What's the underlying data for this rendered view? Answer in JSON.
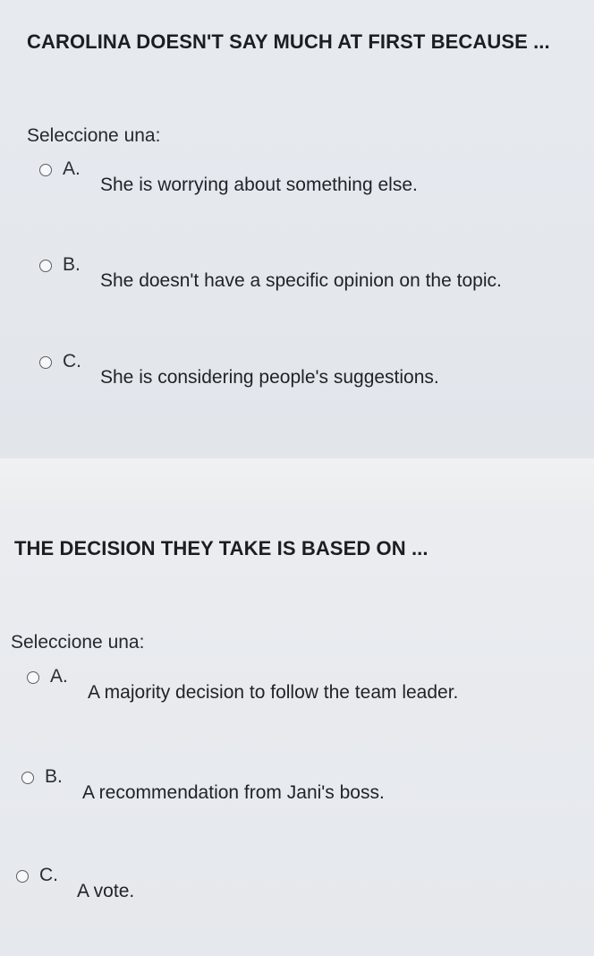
{
  "questions": [
    {
      "title": "CAROLINA DOESN'T SAY MUCH AT FIRST BECAUSE ...",
      "prompt": "Seleccione una:",
      "options": [
        {
          "letter": "A.",
          "text": "She is worrying about something else."
        },
        {
          "letter": "B.",
          "text": "She doesn't have a specific opinion on the topic."
        },
        {
          "letter": "C.",
          "text": "She is considering people's suggestions."
        }
      ]
    },
    {
      "title": "THE DECISION THEY TAKE IS BASED ON ...",
      "prompt": "Seleccione una:",
      "options": [
        {
          "letter": "A.",
          "text": "A majority decision to follow the team leader."
        },
        {
          "letter": "B.",
          "text": "A recommendation from Jani's boss."
        },
        {
          "letter": "C.",
          "text": "A vote."
        }
      ]
    }
  ]
}
